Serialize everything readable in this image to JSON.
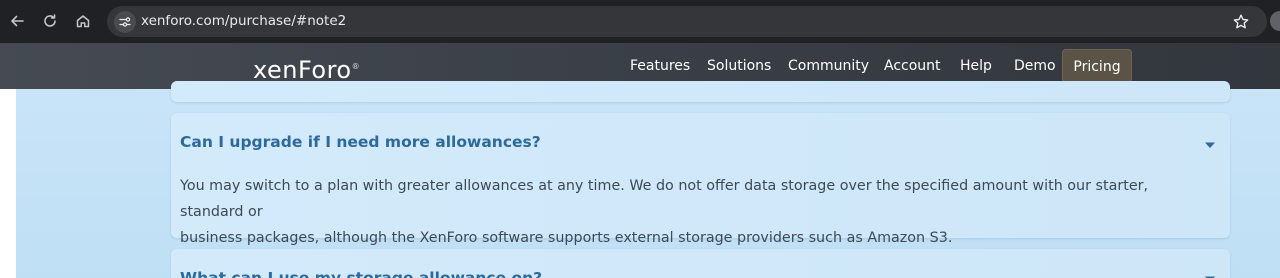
{
  "browser": {
    "url": "xenforo.com/purchase/#note2",
    "icons": {
      "back": "arrow-left-icon",
      "reload": "reload-icon",
      "home": "home-icon",
      "site_info": "tune-icon",
      "bookmark": "star-icon"
    }
  },
  "header": {
    "logo": {
      "part1": "xen",
      "part2": "Foro",
      "tm": "®"
    },
    "nav": [
      {
        "label": "Features"
      },
      {
        "label": "Solutions"
      },
      {
        "label": "Community"
      },
      {
        "label": "Account"
      },
      {
        "label": "Help"
      },
      {
        "label": "Demo"
      },
      {
        "label": "Pricing"
      }
    ]
  },
  "faq": {
    "current": {
      "question": "Can I upgrade if I need more allowances?",
      "answer_line1": "You may switch to a plan with greater allowances at any time. We do not offer data storage over the specified amount with our starter, standard or",
      "answer_line2": "business packages, although the XenForo software supports external storage providers such as Amazon S3.",
      "toggle_icon": "caret-down-icon"
    },
    "next": {
      "question": "What can I use my storage allowance on?",
      "toggle_icon": "caret-down-icon"
    }
  },
  "colors": {
    "accent": "#2b6a9b",
    "header_bg": "#3a3f47",
    "pricing_bg": "#5b5346",
    "page_bg": "#c9e4f8"
  }
}
